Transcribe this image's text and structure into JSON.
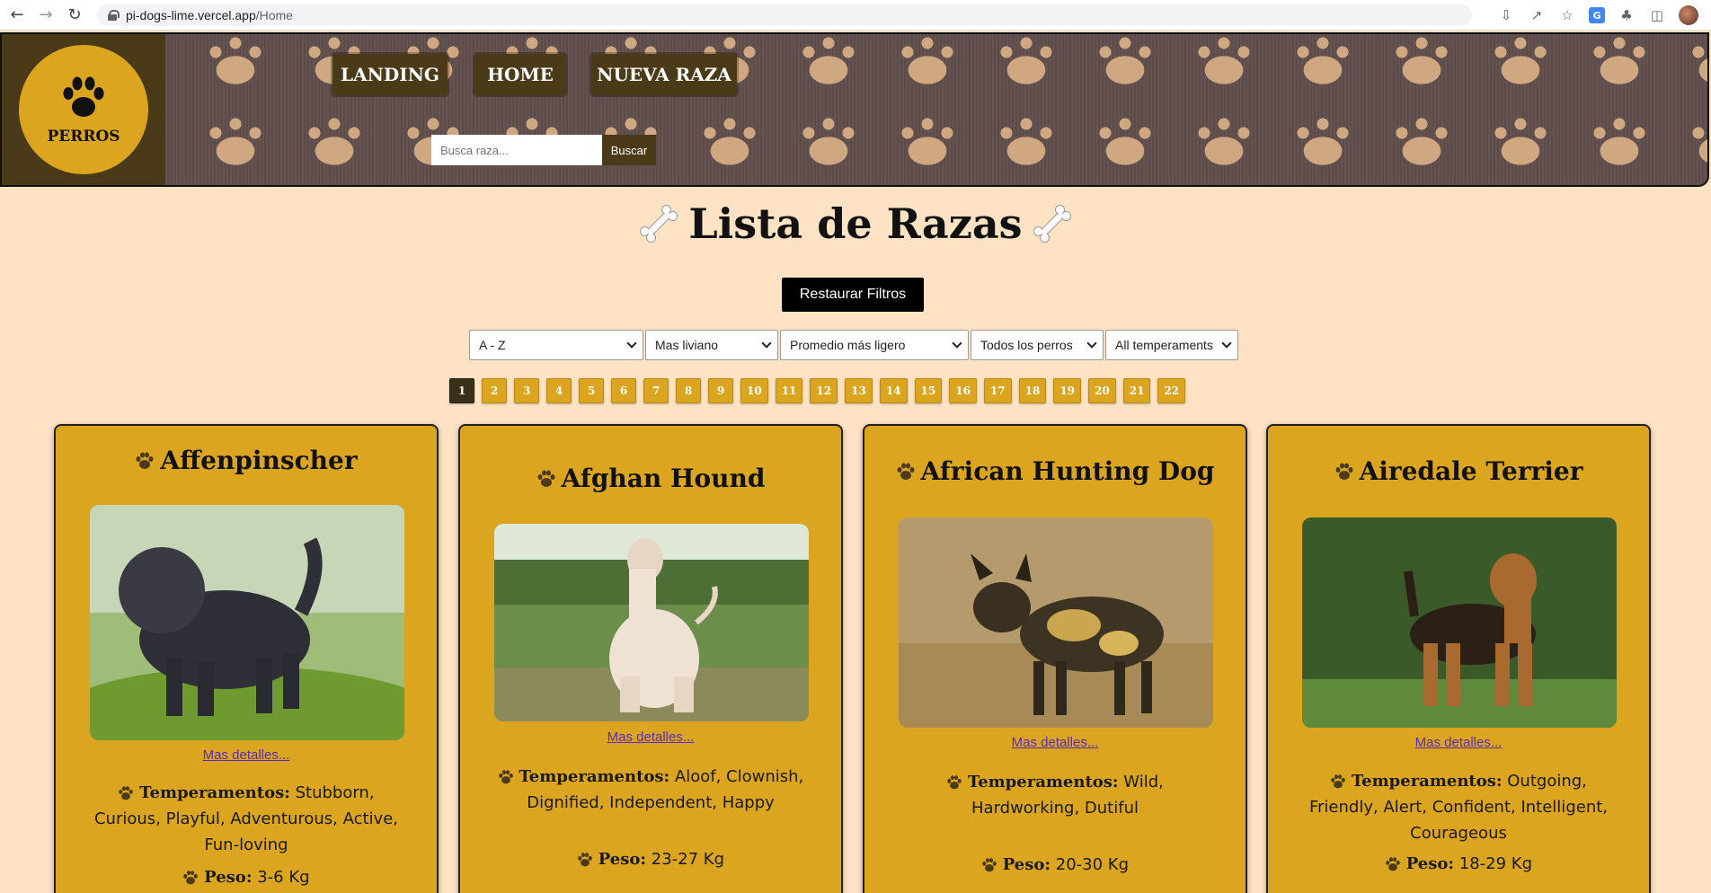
{
  "browser": {
    "url_host": "pi-dogs-lime.vercel.app",
    "url_path": "/Home"
  },
  "header": {
    "logo_text": "PERROS",
    "nav": [
      {
        "label": "LANDING"
      },
      {
        "label": "HOME"
      },
      {
        "label": "NUEVA RAZA"
      }
    ],
    "search_placeholder": "Busca raza...",
    "search_button": "Buscar"
  },
  "main": {
    "title": "Lista de Razas",
    "reset_button": "Restaurar Filtros",
    "filters": [
      {
        "value": "A - Z"
      },
      {
        "value": "Mas liviano"
      },
      {
        "value": "Promedio más ligero"
      },
      {
        "value": "Todos los perros"
      },
      {
        "value": "All temperaments"
      }
    ],
    "pages": [
      "1",
      "2",
      "3",
      "4",
      "5",
      "6",
      "7",
      "8",
      "9",
      "10",
      "11",
      "12",
      "13",
      "14",
      "15",
      "16",
      "17",
      "18",
      "19",
      "20",
      "21",
      "22"
    ],
    "current_page": "1",
    "more_label": "Mas detalles...",
    "temp_label": "Temperamentos:",
    "weight_label": "Peso:",
    "cards": [
      {
        "name": "Affenpinscher",
        "temperaments": "Stubborn, Curious, Playful, Adventurous, Active, Fun-loving",
        "weight": "3-6 Kg"
      },
      {
        "name": "Afghan Hound",
        "temperaments": "Aloof, Clownish, Dignified, Independent, Happy",
        "weight": "23-27 Kg"
      },
      {
        "name": "African Hunting Dog",
        "temperaments": "Wild, Hardworking, Dutiful",
        "weight": "20-30 Kg"
      },
      {
        "name": "Airedale Terrier",
        "temperaments": "Outgoing, Friendly, Alert, Confident, Intelligent, Courageous",
        "weight": "18-29 Kg"
      }
    ]
  },
  "colors": {
    "page_bg": "#fde3c3",
    "card_bg": "#dba51f",
    "dark_brown": "#4a3a18",
    "link": "#5b2bb5"
  }
}
